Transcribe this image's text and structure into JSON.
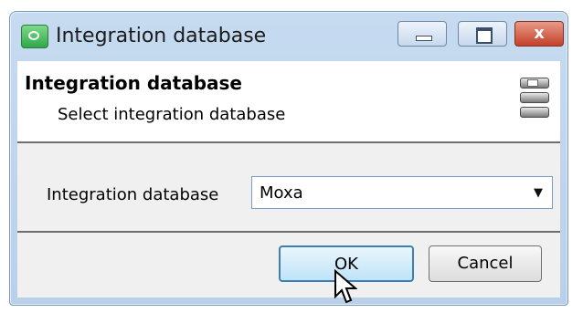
{
  "window": {
    "title": "Integration database",
    "controls": {
      "minimize": "minimize",
      "maximize": "maximize",
      "close": "x"
    }
  },
  "header": {
    "title": "Integration database",
    "subtitle": "Select integration database",
    "icon": "database-icon"
  },
  "form": {
    "label": "Integration database",
    "selected_value": "Moxa"
  },
  "buttons": {
    "ok": "OK",
    "cancel": "Cancel"
  },
  "colors": {
    "titlebar": "#c6dbf0",
    "close_button": "#c4402a",
    "ok_focus_border": "#3c7fb1"
  }
}
